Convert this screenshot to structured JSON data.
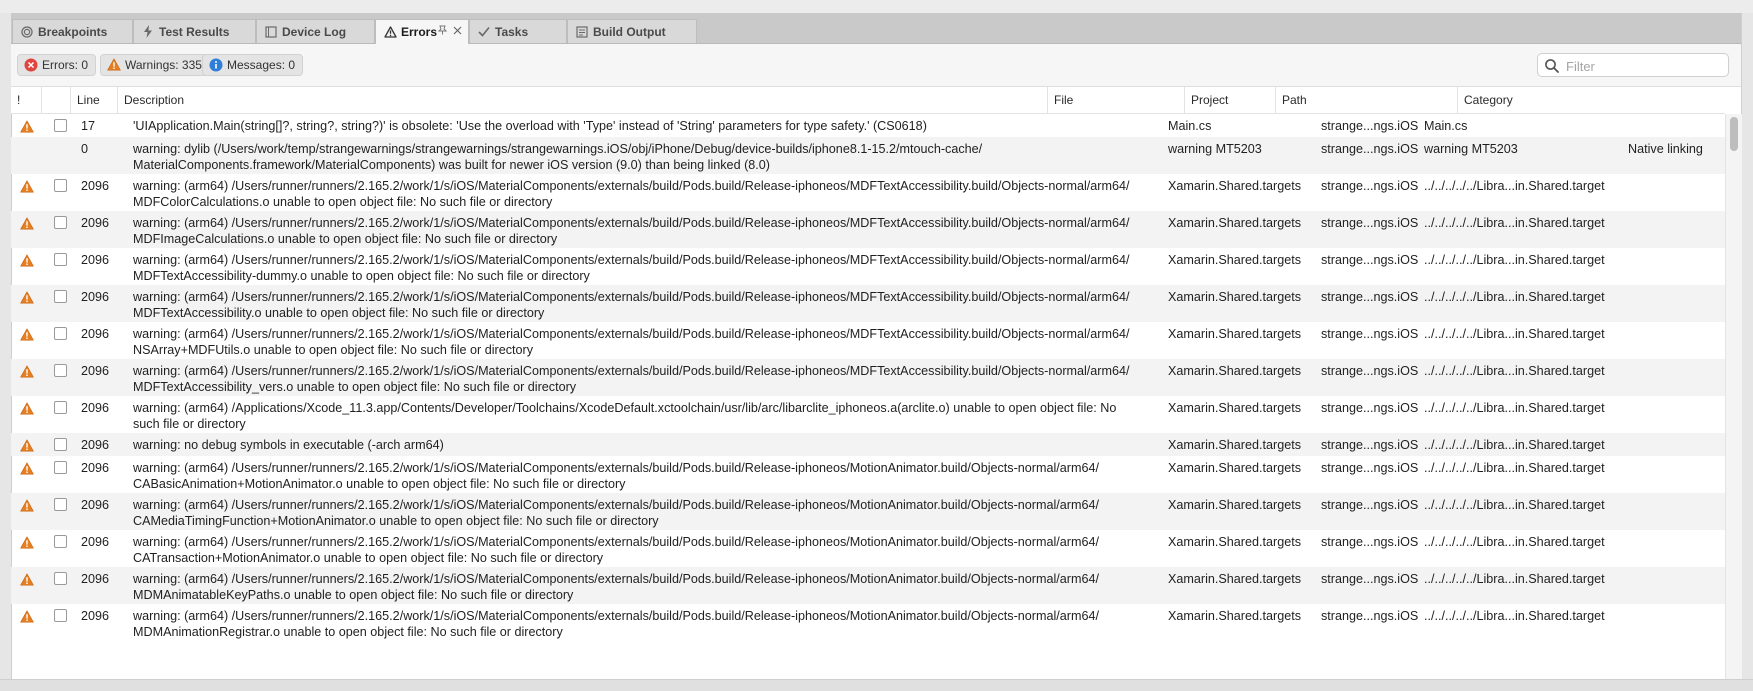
{
  "tabs": [
    {
      "label": "Breakpoints",
      "icon": "breakpoint-icon",
      "active": false
    },
    {
      "label": "Test Results",
      "icon": "test-bolt-icon",
      "active": false
    },
    {
      "label": "Device Log",
      "icon": "device-log-icon",
      "active": false
    },
    {
      "label": "Errors",
      "icon": "warning-triangle-icon",
      "active": true
    },
    {
      "label": "Tasks",
      "icon": "checkmark-icon",
      "active": false
    },
    {
      "label": "Build Output",
      "icon": "build-output-icon",
      "active": false
    }
  ],
  "counts": {
    "errors": "Errors: 0",
    "warnings": "Warnings: 335",
    "messages": "Messages: 0"
  },
  "filter": {
    "placeholder": "Filter",
    "value": ""
  },
  "columns": {
    "severity": "!",
    "line": "Line",
    "description": "Description",
    "file": "File",
    "project": "Project",
    "path": "Path",
    "category": "Category"
  },
  "rows": [
    {
      "icon": "warning-icon",
      "line": "17",
      "desc1": "'UIApplication.Main(string[]?, string?, string?)' is obsolete: 'Use the overload with 'Type' instead of 'String' parameters for type safety.' (CS0618)",
      "desc2": "",
      "file": "Main.cs",
      "project": "strange...ngs.iOS",
      "path": "Main.cs",
      "category": ""
    },
    {
      "icon": "",
      "line": "0",
      "desc1": "warning: dylib (/Users/work/temp/strangewarnings/strangewarnings/strangewarnings.iOS/obj/iPhone/Debug/device-builds/iphone8.1-15.2/mtouch-cache/",
      "desc2": "MaterialComponents.framework/MaterialComponents) was built for newer iOS version (9.0) than being linked (8.0)",
      "file": "warning MT5203",
      "project": "strange...ngs.iOS",
      "path": "warning MT5203",
      "category": "Native linking"
    },
    {
      "icon": "warning-icon",
      "line": "2096",
      "desc1": "warning: (arm64) /Users/runner/runners/2.165.2/work/1/s/iOS/MaterialComponents/externals/build/Pods.build/Release-iphoneos/MDFTextAccessibility.build/Objects-normal/arm64/",
      "desc2": "MDFColorCalculations.o unable to open object file: No such file or directory",
      "file": "Xamarin.Shared.targets",
      "project": "strange...ngs.iOS",
      "path": "../../../../../Libra...in.Shared.targets",
      "category": ""
    },
    {
      "icon": "warning-icon",
      "line": "2096",
      "desc1": "warning: (arm64) /Users/runner/runners/2.165.2/work/1/s/iOS/MaterialComponents/externals/build/Pods.build/Release-iphoneos/MDFTextAccessibility.build/Objects-normal/arm64/",
      "desc2": "MDFImageCalculations.o unable to open object file: No such file or directory",
      "file": "Xamarin.Shared.targets",
      "project": "strange...ngs.iOS",
      "path": "../../../../../Libra...in.Shared.targets",
      "category": ""
    },
    {
      "icon": "warning-icon",
      "line": "2096",
      "desc1": "warning: (arm64) /Users/runner/runners/2.165.2/work/1/s/iOS/MaterialComponents/externals/build/Pods.build/Release-iphoneos/MDFTextAccessibility.build/Objects-normal/arm64/",
      "desc2": "MDFTextAccessibility-dummy.o unable to open object file: No such file or directory",
      "file": "Xamarin.Shared.targets",
      "project": "strange...ngs.iOS",
      "path": "../../../../../Libra...in.Shared.targets",
      "category": ""
    },
    {
      "icon": "warning-icon",
      "line": "2096",
      "desc1": "warning: (arm64) /Users/runner/runners/2.165.2/work/1/s/iOS/MaterialComponents/externals/build/Pods.build/Release-iphoneos/MDFTextAccessibility.build/Objects-normal/arm64/",
      "desc2": "MDFTextAccessibility.o unable to open object file: No such file or directory",
      "file": "Xamarin.Shared.targets",
      "project": "strange...ngs.iOS",
      "path": "../../../../../Libra...in.Shared.targets",
      "category": ""
    },
    {
      "icon": "warning-icon",
      "line": "2096",
      "desc1": "warning: (arm64) /Users/runner/runners/2.165.2/work/1/s/iOS/MaterialComponents/externals/build/Pods.build/Release-iphoneos/MDFTextAccessibility.build/Objects-normal/arm64/",
      "desc2": "NSArray+MDFUtils.o unable to open object file: No such file or directory",
      "file": "Xamarin.Shared.targets",
      "project": "strange...ngs.iOS",
      "path": "../../../../../Libra...in.Shared.targets",
      "category": ""
    },
    {
      "icon": "warning-icon",
      "line": "2096",
      "desc1": "warning: (arm64) /Users/runner/runners/2.165.2/work/1/s/iOS/MaterialComponents/externals/build/Pods.build/Release-iphoneos/MDFTextAccessibility.build/Objects-normal/arm64/",
      "desc2": "MDFTextAccessibility_vers.o unable to open object file: No such file or directory",
      "file": "Xamarin.Shared.targets",
      "project": "strange...ngs.iOS",
      "path": "../../../../../Libra...in.Shared.targets",
      "category": ""
    },
    {
      "icon": "warning-icon",
      "line": "2096",
      "desc1": "warning: (arm64) /Applications/Xcode_11.3.app/Contents/Developer/Toolchains/XcodeDefault.xctoolchain/usr/lib/arc/libarclite_iphoneos.a(arclite.o) unable to open object file: No",
      "desc2": "such file or directory",
      "file": "Xamarin.Shared.targets",
      "project": "strange...ngs.iOS",
      "path": "../../../../../Libra...in.Shared.targets",
      "category": ""
    },
    {
      "icon": "warning-icon",
      "line": "2096",
      "desc1": "warning: no debug symbols in executable (-arch arm64)",
      "desc2": "",
      "file": "Xamarin.Shared.targets",
      "project": "strange...ngs.iOS",
      "path": "../../../../../Libra...in.Shared.targets",
      "category": ""
    },
    {
      "icon": "warning-icon",
      "line": "2096",
      "desc1": "warning: (arm64) /Users/runner/runners/2.165.2/work/1/s/iOS/MaterialComponents/externals/build/Pods.build/Release-iphoneos/MotionAnimator.build/Objects-normal/arm64/",
      "desc2": "CABasicAnimation+MotionAnimator.o unable to open object file: No such file or directory",
      "file": "Xamarin.Shared.targets",
      "project": "strange...ngs.iOS",
      "path": "../../../../../Libra...in.Shared.targets",
      "category": ""
    },
    {
      "icon": "warning-icon",
      "line": "2096",
      "desc1": "warning: (arm64) /Users/runner/runners/2.165.2/work/1/s/iOS/MaterialComponents/externals/build/Pods.build/Release-iphoneos/MotionAnimator.build/Objects-normal/arm64/",
      "desc2": "CAMediaTimingFunction+MotionAnimator.o unable to open object file: No such file or directory",
      "file": "Xamarin.Shared.targets",
      "project": "strange...ngs.iOS",
      "path": "../../../../../Libra...in.Shared.targets",
      "category": ""
    },
    {
      "icon": "warning-icon",
      "line": "2096",
      "desc1": "warning: (arm64) /Users/runner/runners/2.165.2/work/1/s/iOS/MaterialComponents/externals/build/Pods.build/Release-iphoneos/MotionAnimator.build/Objects-normal/arm64/",
      "desc2": "CATransaction+MotionAnimator.o unable to open object file: No such file or directory",
      "file": "Xamarin.Shared.targets",
      "project": "strange...ngs.iOS",
      "path": "../../../../../Libra...in.Shared.targets",
      "category": ""
    },
    {
      "icon": "warning-icon",
      "line": "2096",
      "desc1": "warning: (arm64) /Users/runner/runners/2.165.2/work/1/s/iOS/MaterialComponents/externals/build/Pods.build/Release-iphoneos/MotionAnimator.build/Objects-normal/arm64/",
      "desc2": "MDMAnimatableKeyPaths.o unable to open object file: No such file or directory",
      "file": "Xamarin.Shared.targets",
      "project": "strange...ngs.iOS",
      "path": "../../../../../Libra...in.Shared.targets",
      "category": ""
    },
    {
      "icon": "warning-icon",
      "line": "2096",
      "desc1": "warning: (arm64) /Users/runner/runners/2.165.2/work/1/s/iOS/MaterialComponents/externals/build/Pods.build/Release-iphoneos/MotionAnimator.build/Objects-normal/arm64/",
      "desc2": "MDMAnimationRegistrar.o unable to open object file: No such file or directory",
      "file": "Xamarin.Shared.targets",
      "project": "strange...ngs.iOS",
      "path": "../../../../../Libra...in.Shared.targets",
      "category": ""
    }
  ],
  "colors": {
    "warning": "#e67e22",
    "error": "#e0443e",
    "info": "#2f7fd8",
    "row_alt": "#f3f3f3",
    "tab_strip": "#c9c9c9"
  }
}
